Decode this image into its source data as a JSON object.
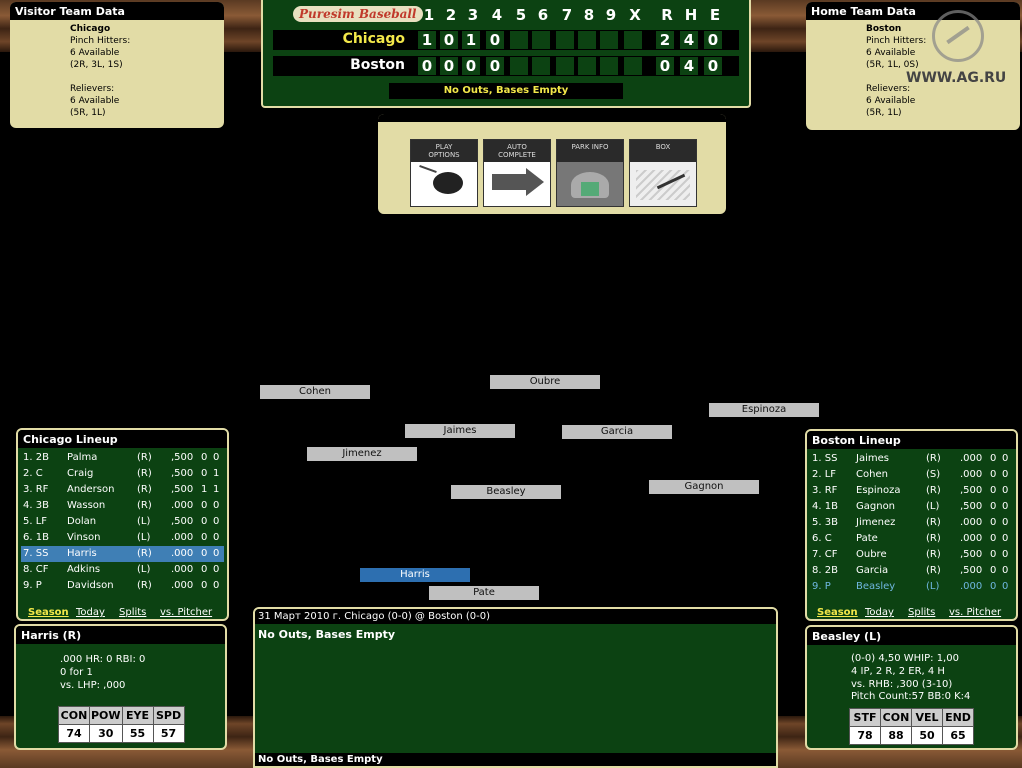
{
  "visitor_panel": {
    "title": "Visitor Team Data",
    "team": "Chicago",
    "ph_label": "Pinch Hitters:",
    "ph_avail": "6 Available",
    "ph_split": "(2R, 3L, 1S)",
    "rel_label": "Relievers:",
    "rel_avail": "6 Available",
    "rel_split": "(5R, 1L)"
  },
  "home_panel": {
    "title": "Home Team Data",
    "team": "Boston",
    "ph_label": "Pinch Hitters:",
    "ph_avail": "6 Available",
    "ph_split": "(5R, 1L, 0S)",
    "rel_label": "Relievers:",
    "rel_avail": "6 Available",
    "rel_split": "(5R, 1L)"
  },
  "watermark": "WWW.AG.RU",
  "scoreboard": {
    "logo": "Puresim Baseball",
    "headers": [
      "1",
      "2",
      "3",
      "4",
      "5",
      "6",
      "7",
      "8",
      "9",
      "X",
      "R",
      "H",
      "E"
    ],
    "rows": [
      {
        "team": "Chicago",
        "cells": [
          "1",
          "0",
          "1",
          "0",
          "",
          "",
          "",
          "",
          "",
          "",
          "2",
          "4",
          "0"
        ]
      },
      {
        "team": "Boston",
        "cells": [
          "0",
          "0",
          "0",
          "0",
          "",
          "",
          "",
          "",
          "",
          "",
          "0",
          "4",
          "0"
        ]
      }
    ],
    "status": "No Outs, Bases Empty"
  },
  "buttons": [
    {
      "label": "PLAY\nOPTIONS",
      "icon": "mouse-icon"
    },
    {
      "label": "AUTO\nCOMPLETE",
      "icon": "arrow-icon"
    },
    {
      "label": "PARK INFO",
      "icon": "stadium-icon"
    },
    {
      "label": "BOX",
      "icon": "scoresheet-icon"
    }
  ],
  "visitor_lineup": {
    "title": "Chicago Lineup",
    "rows": [
      {
        "slot": "1. 2B",
        "name": "Palma",
        "hand": "(R)",
        "avg": ",500",
        "hr": "0",
        "rbi": "0"
      },
      {
        "slot": "2. C",
        "name": "Craig",
        "hand": "(R)",
        "avg": ",500",
        "hr": "0",
        "rbi": "1"
      },
      {
        "slot": "3. RF",
        "name": "Anderson",
        "hand": "(R)",
        "avg": ",500",
        "hr": "1",
        "rbi": "1"
      },
      {
        "slot": "4. 3B",
        "name": "Wasson",
        "hand": "(R)",
        "avg": ".000",
        "hr": "0",
        "rbi": "0"
      },
      {
        "slot": "5. LF",
        "name": "Dolan",
        "hand": "(L)",
        "avg": ",500",
        "hr": "0",
        "rbi": "0"
      },
      {
        "slot": "6. 1B",
        "name": "Vinson",
        "hand": "(L)",
        "avg": ".000",
        "hr": "0",
        "rbi": "0"
      },
      {
        "slot": "7. SS",
        "name": "Harris",
        "hand": "(R)",
        "avg": ".000",
        "hr": "0",
        "rbi": "0"
      },
      {
        "slot": "8. CF",
        "name": "Adkins",
        "hand": "(L)",
        "avg": ".000",
        "hr": "0",
        "rbi": "0"
      },
      {
        "slot": "9. P",
        "name": "Davidson",
        "hand": "(R)",
        "avg": ".000",
        "hr": "0",
        "rbi": "0"
      }
    ],
    "tabs": [
      "Season",
      "Today",
      "Splits",
      "vs. Pitcher"
    ]
  },
  "home_lineup": {
    "title": "Boston Lineup",
    "rows": [
      {
        "slot": "1. SS",
        "name": "Jaimes",
        "hand": "(R)",
        "avg": ".000",
        "hr": "0",
        "rbi": "0"
      },
      {
        "slot": "2. LF",
        "name": "Cohen",
        "hand": "(S)",
        "avg": ".000",
        "hr": "0",
        "rbi": "0"
      },
      {
        "slot": "3. RF",
        "name": "Espinoza",
        "hand": "(R)",
        "avg": ",500",
        "hr": "0",
        "rbi": "0"
      },
      {
        "slot": "4. 1B",
        "name": "Gagnon",
        "hand": "(L)",
        "avg": ",500",
        "hr": "0",
        "rbi": "0"
      },
      {
        "slot": "5. 3B",
        "name": "Jimenez",
        "hand": "(R)",
        "avg": ".000",
        "hr": "0",
        "rbi": "0"
      },
      {
        "slot": "6. C",
        "name": "Pate",
        "hand": "(R)",
        "avg": ".000",
        "hr": "0",
        "rbi": "0"
      },
      {
        "slot": "7. CF",
        "name": "Oubre",
        "hand": "(R)",
        "avg": ",500",
        "hr": "0",
        "rbi": "0"
      },
      {
        "slot": "8. 2B",
        "name": "Garcia",
        "hand": "(R)",
        "avg": ",500",
        "hr": "0",
        "rbi": "0"
      },
      {
        "slot": "9. P",
        "name": "Beasley",
        "hand": "(L)",
        "avg": ".000",
        "hr": "0",
        "rbi": "0"
      }
    ],
    "tabs": [
      "Season",
      "Today",
      "Splits",
      "vs. Pitcher"
    ]
  },
  "fielders": {
    "lf": "Cohen",
    "cf": "Oubre",
    "rf": "Espinoza",
    "ss": "Jaimes",
    "second": "Garcia",
    "third": "Jimenez",
    "first": "Gagnon",
    "pitcher": "Beasley",
    "batter": "Harris",
    "catcher": "Pate"
  },
  "batter_card": {
    "title": "Harris (R)",
    "line1": ".000  HR: 0  RBI: 0",
    "line2": "0 for 1",
    "line3": "vs. LHP: ,000",
    "ratings": {
      "headers": [
        "CON",
        "POW",
        "EYE",
        "SPD"
      ],
      "values": [
        "74",
        "30",
        "55",
        "57"
      ]
    }
  },
  "pitcher_card": {
    "title": "Beasley (L)",
    "line1": "(0-0)  4,50  WHIP: 1,00",
    "line2": "4 IP, 2 R, 2 ER, 4 H",
    "line3": "vs. RHB: ,300 (3-10)",
    "line4": "Pitch Count:57 BB:0 K:4",
    "ratings": {
      "headers": [
        "STF",
        "CON",
        "VEL",
        "END"
      ],
      "values": [
        "78",
        "88",
        "50",
        "65"
      ]
    }
  },
  "log": {
    "header": "31 Март 2010 г. Chicago (0-0) @ Boston (0-0)",
    "body": "No Outs, Bases Empty",
    "footer": "No Outs, Bases Empty"
  },
  "colors": {
    "field_green": "#0c4212",
    "cream": "#e2dca6",
    "highlight": "#3f7fb5",
    "score_yellow": "#f3e84a"
  }
}
